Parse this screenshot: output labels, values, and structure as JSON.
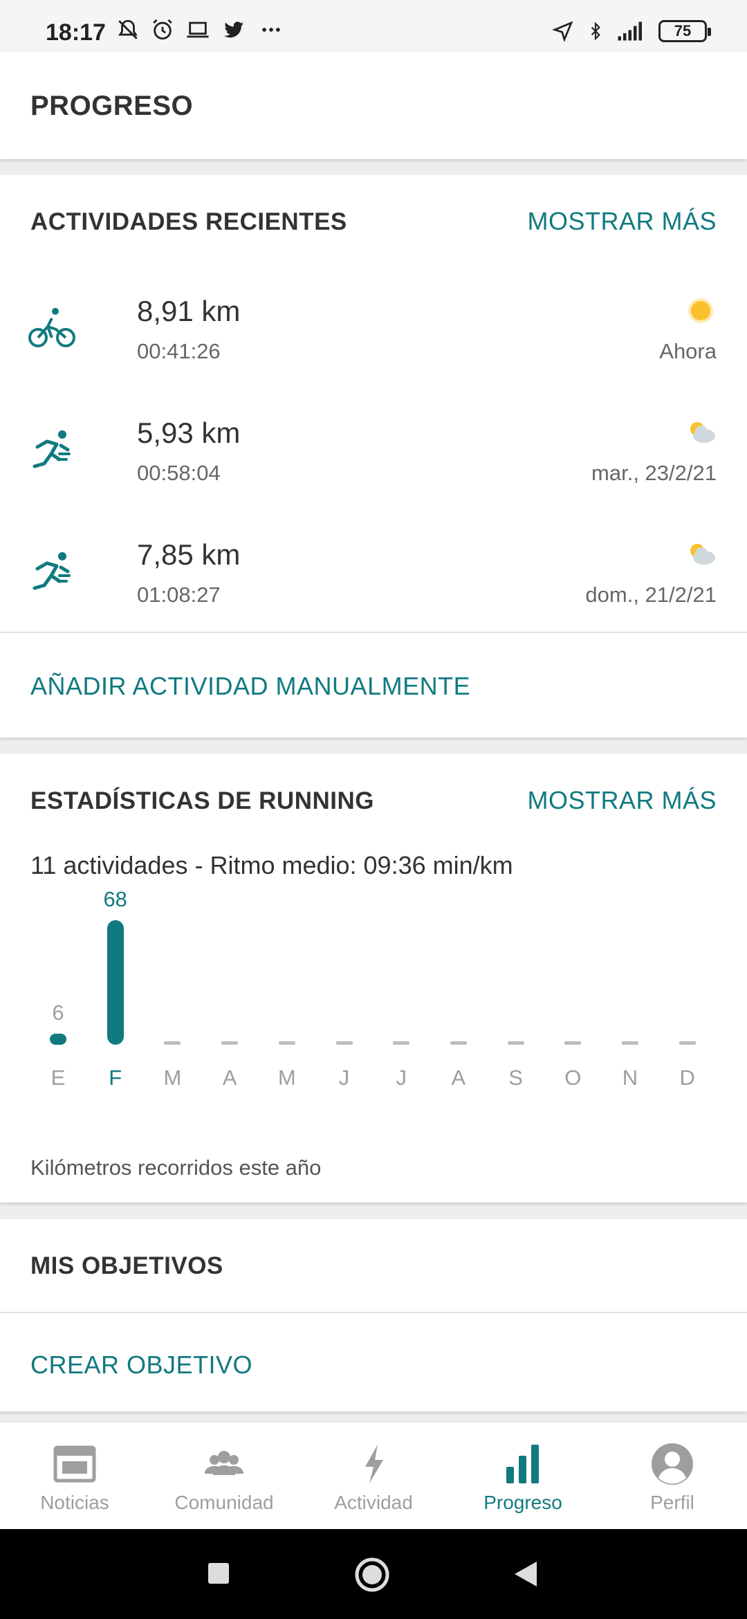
{
  "status_bar": {
    "time": "18:17",
    "battery": "75",
    "icons_left": [
      "muted-bell-icon",
      "alarm-icon",
      "laptop-icon",
      "twitter-icon",
      "more-dots-icon"
    ],
    "icons_right": [
      "location-icon",
      "bluetooth-icon",
      "signal-icon",
      "battery-icon"
    ]
  },
  "header": {
    "title": "PROGRESO"
  },
  "recent": {
    "title": "ACTIVIDADES RECIENTES",
    "more_label": "MOSTRAR MÁS",
    "items": [
      {
        "type_icon": "cycling-icon",
        "distance": "8,91 km",
        "duration": "00:41:26",
        "weather_icon": "sun-icon",
        "date": "Ahora"
      },
      {
        "type_icon": "running-icon",
        "distance": "5,93 km",
        "duration": "00:58:04",
        "weather_icon": "partly-cloudy-icon",
        "date": "mar., 23/2/21"
      },
      {
        "type_icon": "running-icon",
        "distance": "7,85 km",
        "duration": "01:08:27",
        "weather_icon": "partly-cloudy-icon",
        "date": "dom., 21/2/21"
      }
    ],
    "add_manual_label": "AÑADIR ACTIVIDAD MANUALMENTE"
  },
  "stats": {
    "title": "ESTADÍSTICAS DE RUNNING",
    "more_label": "MOSTRAR MÁS",
    "summary": "11 actividades - Ritmo medio: 09:36 min/km",
    "caption": "Kilómetros recorridos este año"
  },
  "chart_data": {
    "type": "bar",
    "categories": [
      "E",
      "F",
      "M",
      "A",
      "M",
      "J",
      "J",
      "A",
      "S",
      "O",
      "N",
      "D"
    ],
    "values": [
      6,
      68,
      0,
      0,
      0,
      0,
      0,
      0,
      0,
      0,
      0,
      0
    ],
    "data_labels": [
      "6",
      "68",
      "",
      "",
      "",
      "",
      "",
      "",
      "",
      "",
      "",
      ""
    ],
    "highlight_index": 1,
    "title": "",
    "xlabel": "",
    "ylabel": "",
    "ylim": [
      0,
      68
    ],
    "grid": false,
    "colors": {
      "bar": "#107a80",
      "empty": "#bdbdbd",
      "highlight_label": "#107a80",
      "label": "#9e9e9e"
    }
  },
  "goals": {
    "title": "MIS OBJETIVOS",
    "create_label": "CREAR OBJETIVO"
  },
  "bottom_nav": {
    "items": [
      {
        "label": "Noticias",
        "icon": "newspaper-icon",
        "active": false
      },
      {
        "label": "Comunidad",
        "icon": "community-icon",
        "active": false
      },
      {
        "label": "Actividad",
        "icon": "lightning-icon",
        "active": false
      },
      {
        "label": "Progreso",
        "icon": "bar-chart-icon",
        "active": true
      },
      {
        "label": "Perfil",
        "icon": "profile-icon",
        "active": false
      }
    ]
  },
  "colors": {
    "accent": "#107a80",
    "text": "#333333",
    "muted": "#9e9e9e",
    "sun": "#fbc02d"
  }
}
